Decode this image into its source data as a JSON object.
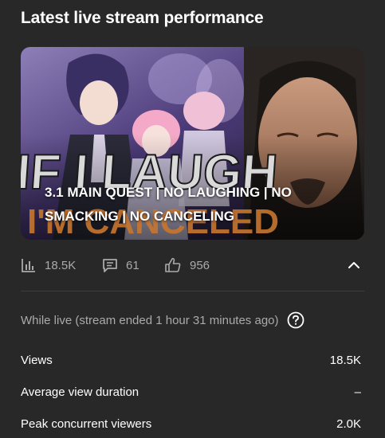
{
  "card": {
    "title": "Latest live stream performance"
  },
  "thumbnail": {
    "caption_line1": "3.1 MAIN QUEST | NO LAUGHING | NO",
    "caption_line2": "SMACKING | NO CANCELING",
    "overlay_line1": "IF I LAUGH",
    "overlay_line2": "I'M CANCELED"
  },
  "stats": {
    "views": "18.5K",
    "comments": "61",
    "likes": "956"
  },
  "icons": {
    "views": "bar-chart-icon",
    "comments": "comment-icon",
    "likes": "thumbs-up-icon",
    "collapse": "chevron-up-icon",
    "help": "help-circle-icon"
  },
  "live_note": "While live (stream ended 1 hour 31 minutes ago)",
  "metrics": [
    {
      "label": "Views",
      "value": "18.5K"
    },
    {
      "label": "Average view duration",
      "value": "–"
    },
    {
      "label": "Peak concurrent viewers",
      "value": "2.0K"
    }
  ],
  "colors": {
    "background": "#282828",
    "muted_text": "#aaaaaa",
    "divider": "#3d3d3d"
  }
}
